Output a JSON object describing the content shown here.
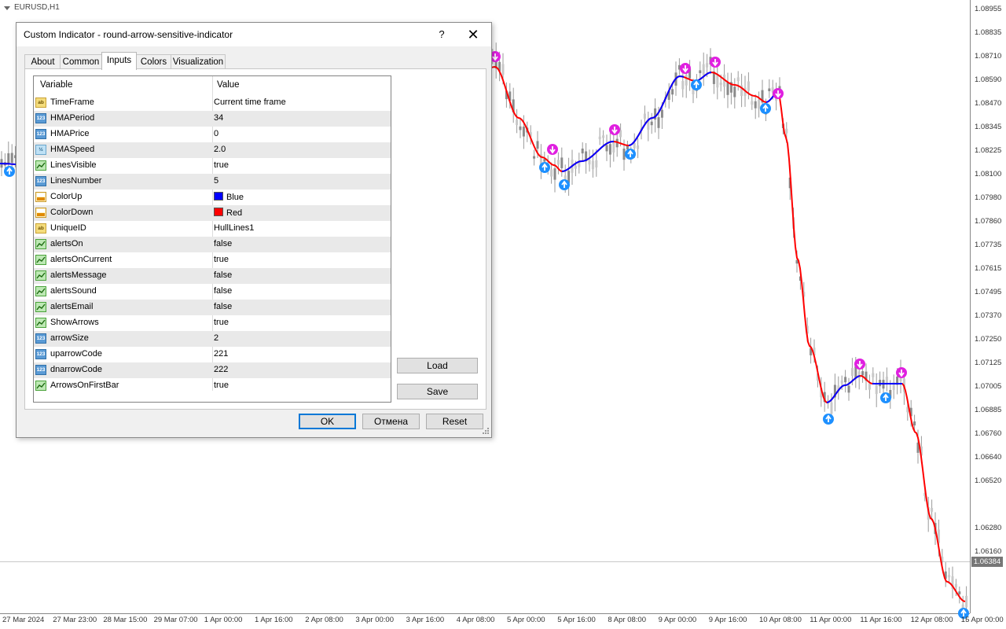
{
  "chart": {
    "symbol": "EURUSD,H1",
    "current_price": "1.06384",
    "price_labels": [
      "1.08955",
      "1.08835",
      "1.08710",
      "1.08590",
      "1.08470",
      "1.08345",
      "1.08225",
      "1.08100",
      "1.07980",
      "1.07860",
      "1.07735",
      "1.07615",
      "1.07495",
      "1.07370",
      "1.07250",
      "1.07125",
      "1.07005",
      "1.06885",
      "1.06760",
      "1.06640",
      "1.06520",
      "1.06280",
      "1.06160"
    ],
    "time_labels": [
      "27 Mar 2024",
      "27 Mar 23:00",
      "28 Mar 15:00",
      "29 Mar 07:00",
      "1 Apr 00:00",
      "1 Apr 16:00",
      "2 Apr 08:00",
      "3 Apr 00:00",
      "3 Apr 16:00",
      "4 Apr 08:00",
      "5 Apr 00:00",
      "5 Apr 16:00",
      "8 Apr 08:00",
      "9 Apr 00:00",
      "9 Apr 16:00",
      "10 Apr 08:00",
      "11 Apr 00:00",
      "11 Apr 16:00",
      "12 Apr 08:00",
      "15 Apr 00:00"
    ],
    "colors": {
      "up": "#0000ff",
      "down": "#ff0000",
      "up_arrow": "#1e90ff",
      "down_arrow": "#e020e0",
      "candle": "#9a9a9a"
    }
  },
  "dialog": {
    "title": "Custom Indicator - round-arrow-sensitive-indicator",
    "help": "?",
    "close": "✕",
    "tabs": [
      {
        "label": "About"
      },
      {
        "label": "Common"
      },
      {
        "label": "Inputs"
      },
      {
        "label": "Colors"
      },
      {
        "label": "Visualization"
      }
    ],
    "active_tab": "Inputs",
    "headers": {
      "variable": "Variable",
      "value": "Value"
    },
    "rows": [
      {
        "name": "TimeFrame",
        "value": "Current time frame",
        "icon": "string-icon"
      },
      {
        "name": "HMAPeriod",
        "value": "34",
        "icon": "integer-icon"
      },
      {
        "name": "HMAPrice",
        "value": "0",
        "icon": "integer-icon"
      },
      {
        "name": "HMASpeed",
        "value": "2.0",
        "icon": "double-icon"
      },
      {
        "name": "LinesVisible",
        "value": "true",
        "icon": "bool-icon"
      },
      {
        "name": "LinesNumber",
        "value": "5",
        "icon": "integer-icon"
      },
      {
        "name": "ColorUp",
        "value": "Blue",
        "icon": "color-icon",
        "swatch": "#0000ff"
      },
      {
        "name": "ColorDown",
        "value": "Red",
        "icon": "color-icon",
        "swatch": "#ff0000"
      },
      {
        "name": "UniqueID",
        "value": "HullLines1",
        "icon": "string-icon"
      },
      {
        "name": "alertsOn",
        "value": "false",
        "icon": "bool-icon"
      },
      {
        "name": "alertsOnCurrent",
        "value": "true",
        "icon": "bool-icon"
      },
      {
        "name": "alertsMessage",
        "value": "false",
        "icon": "bool-icon"
      },
      {
        "name": "alertsSound",
        "value": "false",
        "icon": "bool-icon"
      },
      {
        "name": "alertsEmail",
        "value": "false",
        "icon": "bool-icon"
      },
      {
        "name": "ShowArrows",
        "value": "true",
        "icon": "bool-icon"
      },
      {
        "name": "arrowSize",
        "value": "2",
        "icon": "integer-icon"
      },
      {
        "name": "uparrowCode",
        "value": "221",
        "icon": "integer-icon"
      },
      {
        "name": "dnarrowCode",
        "value": "222",
        "icon": "integer-icon"
      },
      {
        "name": "ArrowsOnFirstBar",
        "value": "true",
        "icon": "bool-icon"
      }
    ],
    "load_label": "Load",
    "save_label": "Save",
    "ok_label": "OK",
    "cancel_label": "Отмена",
    "reset_label": "Reset"
  }
}
